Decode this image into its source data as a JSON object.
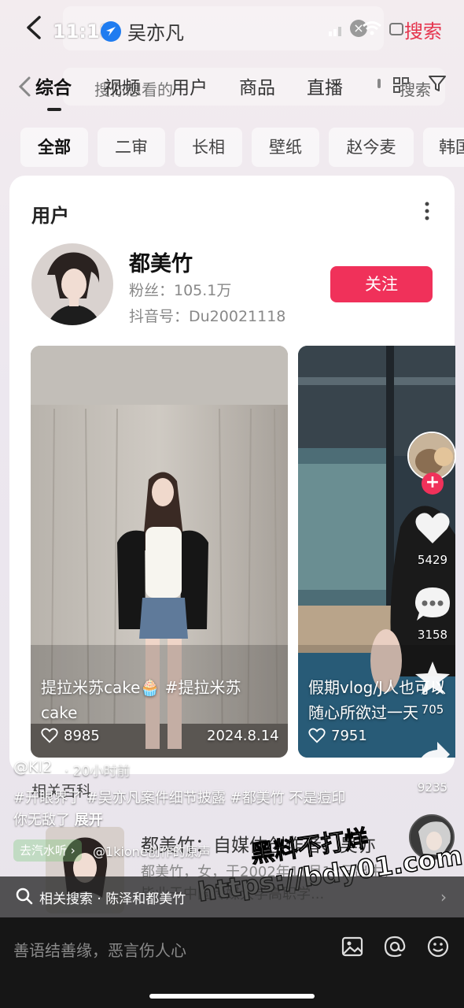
{
  "status": {
    "time": "11:18"
  },
  "search": {
    "query": "吴亦凡",
    "button_label": "搜索",
    "overlay_hint": "搜你想看的",
    "overlay_button": "搜索"
  },
  "tabs": [
    {
      "label": "综合",
      "active": true
    },
    {
      "label": "视频"
    },
    {
      "label": "用户"
    },
    {
      "label": "商品"
    },
    {
      "label": "直播"
    }
  ],
  "chips": [
    {
      "label": "全部",
      "active": true
    },
    {
      "label": "二审"
    },
    {
      "label": "长相"
    },
    {
      "label": "壁纸"
    },
    {
      "label": "赵今麦"
    },
    {
      "label": "韩国"
    }
  ],
  "user_card": {
    "section_title": "用户",
    "name": "都美竹",
    "fans": "粉丝：105.1万",
    "douyin_id": "抖音号：Du20021118",
    "follow_label": "关注"
  },
  "videos": [
    {
      "title": "提拉米苏cake🧁 #提拉米苏cake",
      "likes": "8985",
      "date": "2024.8.14"
    },
    {
      "title": "假期vlog/J人也可以随心所欲过一天",
      "likes": "7951"
    }
  ],
  "side_actions": {
    "likes": "5429",
    "comments": "3158",
    "favorites": "705",
    "shares": "9235"
  },
  "post": {
    "author": "@KI2",
    "time": "· 20小时前",
    "text": "#开眼界了 #吴亦凡案件细节披露 #都美竹 不是痘印你无敌了",
    "expand": "展开",
    "music_chip": "去汽水听 ›",
    "music_text": "@1kione创作的原声"
  },
  "wiki": {
    "section": "相关百科",
    "title": "都美竹：自媒体创作者、吴亦",
    "desc": "都美竹，女，于2002年11月18日出生，毕业于中国传媒大学高职学..."
  },
  "watermark": {
    "line1": "黑料不打烊",
    "line2": "https://bdy01.com"
  },
  "related": {
    "label": "相关搜索 · 陈泽和都美竹"
  },
  "comment_bar": {
    "placeholder": "善语结善缘，恶言伤人心"
  },
  "colors": {
    "accent": "#f0315a",
    "search_red": "#e5344d"
  }
}
